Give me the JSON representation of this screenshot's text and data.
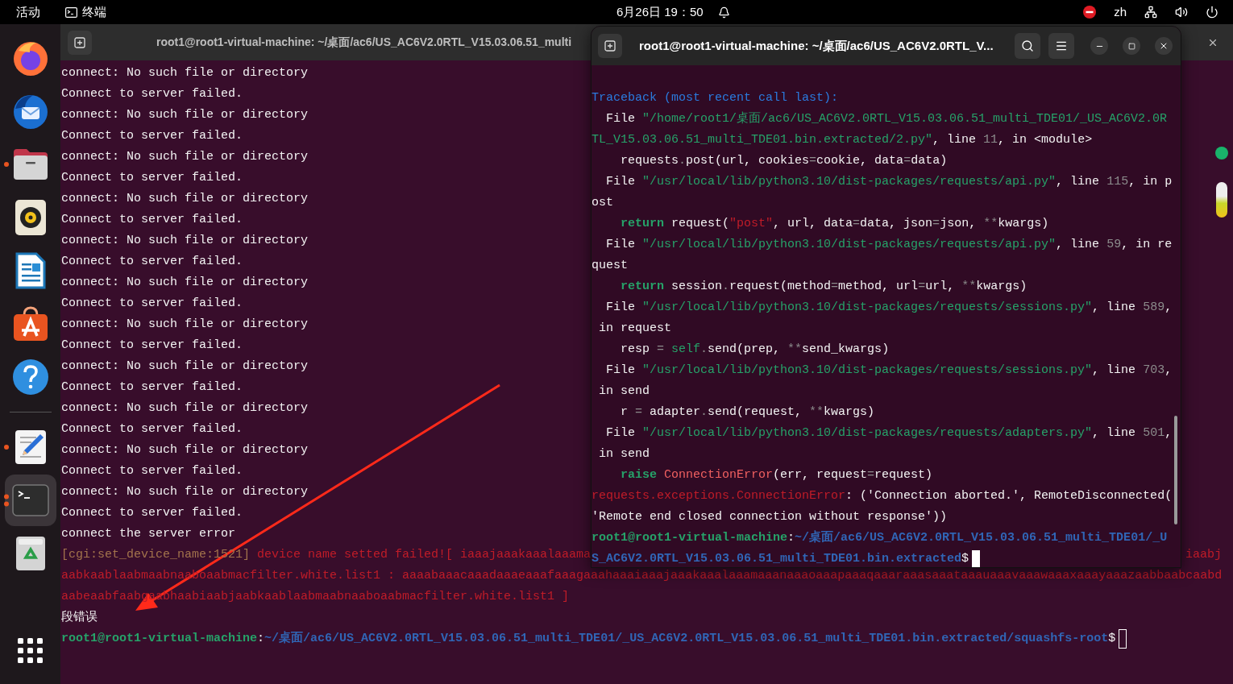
{
  "top_bar": {
    "activities": "活动",
    "app": "终端",
    "clock": "6月26日 19：50",
    "tray": [
      {
        "kind": "blocked"
      },
      {
        "kind": "text",
        "text": "zh"
      },
      {
        "kind": "network"
      },
      {
        "kind": "volume"
      },
      {
        "kind": "power"
      }
    ]
  },
  "dock": {
    "items": [
      {
        "kind": "browser",
        "running": false,
        "multiple_windows": false,
        "selected": false
      },
      {
        "kind": "mail",
        "running": false,
        "multiple_windows": false,
        "selected": false
      },
      {
        "kind": "files",
        "running": true,
        "multiple_windows": false,
        "selected": false
      },
      {
        "kind": "music",
        "running": false,
        "multiple_windows": false,
        "selected": false
      },
      {
        "kind": "writer",
        "running": false,
        "multiple_windows": false,
        "selected": false
      },
      {
        "kind": "store",
        "running": false,
        "multiple_windows": false,
        "selected": false
      },
      {
        "kind": "help",
        "running": false,
        "multiple_windows": false,
        "selected": false
      },
      {
        "kind": "separator"
      },
      {
        "kind": "editor",
        "running": true,
        "multiple_windows": false,
        "selected": false
      },
      {
        "kind": "terminal",
        "running": true,
        "multiple_windows": true,
        "selected": true
      },
      {
        "kind": "trash",
        "running": false,
        "multiple_windows": false,
        "selected": false
      },
      {
        "kind": "apps",
        "running": false,
        "multiple_windows": false,
        "selected": false
      }
    ]
  },
  "back_terminal": {
    "title": "root1@root1-virtual-machine: ~/桌面/ac6/US_AC6V2.0RTL_V15.03.06.51_multi",
    "lines": [
      {
        "segments": [
          {
            "kind": "plain",
            "text": "connect: No such file or directory"
          }
        ]
      },
      {
        "segments": [
          {
            "kind": "plain",
            "text": "Connect to server failed."
          }
        ]
      },
      {
        "segments": [
          {
            "kind": "plain",
            "text": "connect: No such file or directory"
          }
        ]
      },
      {
        "segments": [
          {
            "kind": "plain",
            "text": "Connect to server failed."
          }
        ]
      },
      {
        "segments": [
          {
            "kind": "plain",
            "text": "connect: No such file or directory"
          }
        ]
      },
      {
        "segments": [
          {
            "kind": "plain",
            "text": "Connect to server failed."
          }
        ]
      },
      {
        "segments": [
          {
            "kind": "plain",
            "text": "connect: No such file or directory"
          }
        ]
      },
      {
        "segments": [
          {
            "kind": "plain",
            "text": "Connect to server failed."
          }
        ]
      },
      {
        "segments": [
          {
            "kind": "plain",
            "text": "connect: No such file or directory"
          }
        ]
      },
      {
        "segments": [
          {
            "kind": "plain",
            "text": "Connect to server failed."
          }
        ]
      },
      {
        "segments": [
          {
            "kind": "plain",
            "text": "connect: No such file or directory"
          }
        ]
      },
      {
        "segments": [
          {
            "kind": "plain",
            "text": "Connect to server failed."
          }
        ]
      },
      {
        "segments": [
          {
            "kind": "plain",
            "text": "connect: No such file or directory"
          }
        ]
      },
      {
        "segments": [
          {
            "kind": "plain",
            "text": "Connect to server failed."
          }
        ]
      },
      {
        "segments": [
          {
            "kind": "plain",
            "text": "connect: No such file or directory"
          }
        ]
      },
      {
        "segments": [
          {
            "kind": "plain",
            "text": "Connect to server failed."
          }
        ]
      },
      {
        "segments": [
          {
            "kind": "plain",
            "text": "connect: No such file or directory"
          }
        ]
      },
      {
        "segments": [
          {
            "kind": "plain",
            "text": "Connect to server failed."
          }
        ]
      },
      {
        "segments": [
          {
            "kind": "plain",
            "text": "connect: No such file or directory"
          }
        ]
      },
      {
        "segments": [
          {
            "kind": "plain",
            "text": "Connect to server failed."
          }
        ]
      },
      {
        "segments": [
          {
            "kind": "plain",
            "text": "connect: No such file or directory"
          }
        ]
      },
      {
        "segments": [
          {
            "kind": "plain",
            "text": "Connect to server failed."
          }
        ]
      },
      {
        "segments": [
          {
            "kind": "plain",
            "text": "connect the server error"
          }
        ]
      },
      {
        "segments": [
          {
            "kind": "tag",
            "text": "[cgi:set_device_name:1521]"
          },
          {
            "kind": "error",
            "text": " device name setted failed![ iaaajaaakaaalaaama"
          }
        ],
        "tail": [
          {
            "kind": "error",
            "text": "iaabj"
          }
        ]
      },
      {
        "segments": [
          {
            "kind": "error",
            "text": "aabkaablaabmaabnaaboaabmacfilter.white.list1 : aaaabaaacaaadaaaeaaafaaagaaahaaaiaaajaaakaaalaaamaaanaaaoaaapaaaqaaaraaasaaataaauaaavaaawaaaxaaayaaazaabbaabcaabd"
          }
        ]
      },
      {
        "segments": [
          {
            "kind": "error",
            "text": "aabeaabfaabgaabhaabiaabjaabkaablaabmaabnaaboaabmacfilter.white.list1 ]"
          }
        ]
      },
      {
        "segments": [
          {
            "kind": "plain",
            "text": "段错误"
          }
        ]
      },
      {
        "segments": [
          {
            "kind": "user",
            "text": "root1@root1-virtual-machine"
          },
          {
            "kind": "plain",
            "text": ":"
          },
          {
            "kind": "path",
            "text": "~/桌面/ac6/US_AC6V2.0RTL_V15.03.06.51_multi_TDE01/_US_AC6V2.0RTL_V15.03.06.51_multi_TDE01.bin.extracted/squashfs-root"
          },
          {
            "kind": "plain",
            "text": "$"
          }
        ],
        "cursor": {
          "filled": false
        }
      }
    ]
  },
  "front_terminal": {
    "title": "root1@root1-virtual-machine: ~/桌面/ac6/US_AC6V2.0RTL_V...",
    "lines": [
      {
        "segments": [
          {
            "kind": "heading",
            "text": "Traceback (most recent call last):"
          }
        ]
      },
      {
        "segments": [
          {
            "kind": "plain",
            "text": "  File "
          },
          {
            "kind": "string",
            "text": "\"/home/root1/桌面/ac6/US_AC6V2.0RTL_V15.03.06.51_multi_TDE01/_US_AC6V2.0R"
          }
        ]
      },
      {
        "segments": [
          {
            "kind": "string",
            "text": "TL_V15.03.06.51_multi_TDE01.bin.extracted/2.py\""
          },
          {
            "kind": "plain",
            "text": ", line "
          },
          {
            "kind": "number",
            "text": "11"
          },
          {
            "kind": "plain",
            "text": ", in <module>"
          }
        ]
      },
      {
        "segments": [
          {
            "kind": "plain",
            "text": "    requests"
          },
          {
            "kind": "operator",
            "text": "."
          },
          {
            "kind": "plain",
            "text": "post(url, cookies"
          },
          {
            "kind": "operator",
            "text": "="
          },
          {
            "kind": "plain",
            "text": "cookie, data"
          },
          {
            "kind": "operator",
            "text": "="
          },
          {
            "kind": "plain",
            "text": "data)"
          }
        ]
      },
      {
        "segments": [
          {
            "kind": "plain",
            "text": "  File "
          },
          {
            "kind": "string",
            "text": "\"/usr/local/lib/python3.10/dist-packages/requests/api.py\""
          },
          {
            "kind": "plain",
            "text": ", line "
          },
          {
            "kind": "number",
            "text": "115"
          },
          {
            "kind": "plain",
            "text": ", in p"
          }
        ]
      },
      {
        "segments": [
          {
            "kind": "plain",
            "text": "ost"
          }
        ]
      },
      {
        "segments": [
          {
            "kind": "keyword",
            "text": "    return"
          },
          {
            "kind": "plain",
            "text": " request("
          },
          {
            "kind": "literal",
            "text": "\"post\""
          },
          {
            "kind": "plain",
            "text": ", url, data"
          },
          {
            "kind": "operator",
            "text": "="
          },
          {
            "kind": "plain",
            "text": "data, json"
          },
          {
            "kind": "operator",
            "text": "="
          },
          {
            "kind": "plain",
            "text": "json, "
          },
          {
            "kind": "operator",
            "text": "**"
          },
          {
            "kind": "plain",
            "text": "kwargs)"
          }
        ]
      },
      {
        "segments": [
          {
            "kind": "plain",
            "text": "  File "
          },
          {
            "kind": "string",
            "text": "\"/usr/local/lib/python3.10/dist-packages/requests/api.py\""
          },
          {
            "kind": "plain",
            "text": ", line "
          },
          {
            "kind": "number",
            "text": "59"
          },
          {
            "kind": "plain",
            "text": ", in re"
          }
        ]
      },
      {
        "segments": [
          {
            "kind": "plain",
            "text": "quest"
          }
        ]
      },
      {
        "segments": [
          {
            "kind": "keyword",
            "text": "    return"
          },
          {
            "kind": "plain",
            "text": " session"
          },
          {
            "kind": "operator",
            "text": "."
          },
          {
            "kind": "plain",
            "text": "request(method"
          },
          {
            "kind": "operator",
            "text": "="
          },
          {
            "kind": "plain",
            "text": "method, url"
          },
          {
            "kind": "operator",
            "text": "="
          },
          {
            "kind": "plain",
            "text": "url, "
          },
          {
            "kind": "operator",
            "text": "**"
          },
          {
            "kind": "plain",
            "text": "kwargs)"
          }
        ]
      },
      {
        "segments": [
          {
            "kind": "plain",
            "text": "  File "
          },
          {
            "kind": "string",
            "text": "\"/usr/local/lib/python3.10/dist-packages/requests/sessions.py\""
          },
          {
            "kind": "plain",
            "text": ", line "
          },
          {
            "kind": "number",
            "text": "589"
          },
          {
            "kind": "plain",
            "text": ","
          }
        ]
      },
      {
        "segments": [
          {
            "kind": "plain",
            "text": " in request"
          }
        ]
      },
      {
        "segments": [
          {
            "kind": "plain",
            "text": "    resp "
          },
          {
            "kind": "operator",
            "text": "="
          },
          {
            "kind": "builtin",
            "text": " self"
          },
          {
            "kind": "operator",
            "text": "."
          },
          {
            "kind": "plain",
            "text": "send(prep, "
          },
          {
            "kind": "operator",
            "text": "**"
          },
          {
            "kind": "plain",
            "text": "send_kwargs)"
          }
        ]
      },
      {
        "segments": [
          {
            "kind": "plain",
            "text": "  File "
          },
          {
            "kind": "string",
            "text": "\"/usr/local/lib/python3.10/dist-packages/requests/sessions.py\""
          },
          {
            "kind": "plain",
            "text": ", line "
          },
          {
            "kind": "number",
            "text": "703"
          },
          {
            "kind": "plain",
            "text": ","
          }
        ]
      },
      {
        "segments": [
          {
            "kind": "plain",
            "text": " in send"
          }
        ]
      },
      {
        "segments": [
          {
            "kind": "plain",
            "text": "    r "
          },
          {
            "kind": "operator",
            "text": "="
          },
          {
            "kind": "plain",
            "text": " adapter"
          },
          {
            "kind": "operator",
            "text": "."
          },
          {
            "kind": "plain",
            "text": "send(request, "
          },
          {
            "kind": "operator",
            "text": "**"
          },
          {
            "kind": "plain",
            "text": "kwargs)"
          }
        ]
      },
      {
        "segments": [
          {
            "kind": "plain",
            "text": "  File "
          },
          {
            "kind": "string",
            "text": "\"/usr/local/lib/python3.10/dist-packages/requests/adapters.py\""
          },
          {
            "kind": "plain",
            "text": ", line "
          },
          {
            "kind": "number",
            "text": "501"
          },
          {
            "kind": "plain",
            "text": ","
          }
        ]
      },
      {
        "segments": [
          {
            "kind": "plain",
            "text": " in send"
          }
        ]
      },
      {
        "segments": [
          {
            "kind": "keyword",
            "text": "    raise"
          },
          {
            "kind": "exc_class",
            "text": " ConnectionError"
          },
          {
            "kind": "plain",
            "text": "(err, request"
          },
          {
            "kind": "operator",
            "text": "="
          },
          {
            "kind": "plain",
            "text": "request)"
          }
        ]
      },
      {
        "segments": [
          {
            "kind": "error",
            "text": "requests.exceptions.ConnectionError"
          },
          {
            "kind": "plain",
            "text": ": ('Connection aborted.', RemoteDisconnected("
          }
        ]
      },
      {
        "segments": [
          {
            "kind": "plain",
            "text": "'Remote end closed connection without response'))"
          }
        ]
      },
      {
        "segments": [
          {
            "kind": "user",
            "text": "root1@root1-virtual-machine"
          },
          {
            "kind": "plain",
            "text": ":"
          },
          {
            "kind": "path",
            "text": "~/桌面/ac6/US_AC6V2.0RTL_V15.03.06.51_multi_TDE01/_U"
          }
        ]
      },
      {
        "segments": [
          {
            "kind": "path",
            "text": "S_AC6V2.0RTL_V15.03.06.51_multi_TDE01.bin.extracted"
          },
          {
            "kind": "plain",
            "text": "$"
          }
        ],
        "cursor": {
          "filled": true
        }
      }
    ]
  }
}
